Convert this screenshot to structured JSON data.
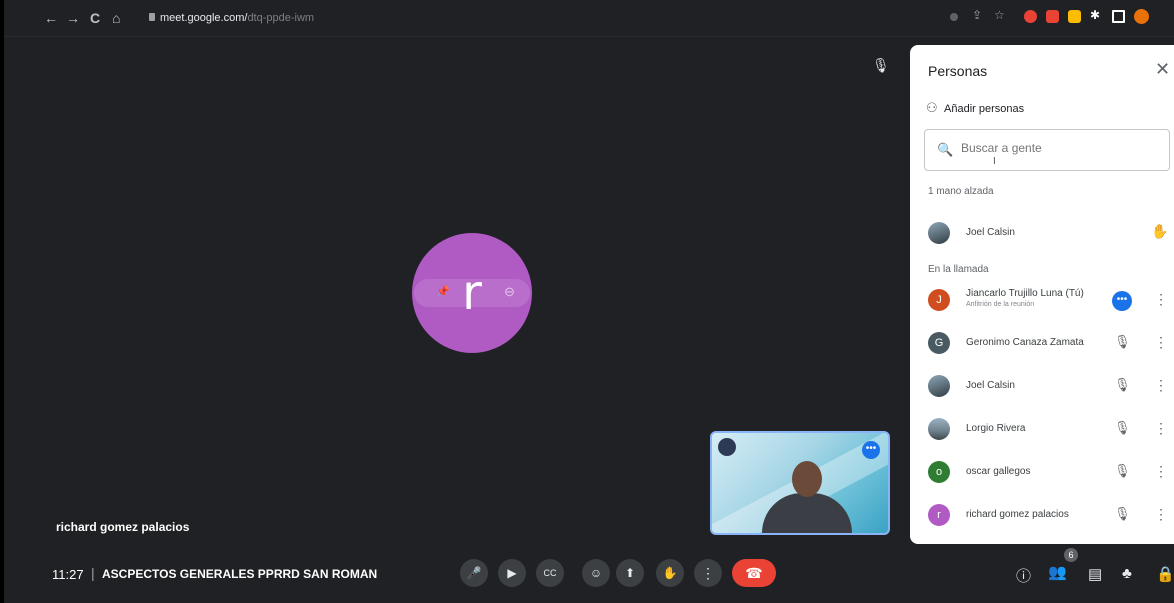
{
  "browser": {
    "url_host": "meet.google.com/",
    "url_path": "dtq-ppde-iwm",
    "nav": [
      "←",
      "→",
      "C",
      "⌂"
    ]
  },
  "stage": {
    "avatar_letter": "r",
    "tile_name": "richard gomez palacios",
    "avatar_color": "#b05bc4"
  },
  "panel": {
    "title": "Personas",
    "add_people": "Añadir personas",
    "search_placeholder": "Buscar a gente",
    "raised_hands_label": "1 mano alzada",
    "raised": [
      {
        "name": "Joel Calsin"
      }
    ],
    "in_call_label": "En la llamada",
    "in_call": [
      {
        "name": "Jiancarlo Trujillo Luna (Tú)",
        "subtitle": "Anfitrión de la reunión",
        "initial": "J",
        "color": "#d04d1f"
      },
      {
        "name": "Geronimo Canaza Zamata",
        "initial": "G",
        "color": "#4a5a63"
      },
      {
        "name": "Joel Calsin",
        "initial": "",
        "color": ""
      },
      {
        "name": "Lorgio Rivera",
        "initial": "",
        "color": ""
      },
      {
        "name": "oscar gallegos",
        "initial": "o",
        "color": "#2e7d32"
      },
      {
        "name": "richard gomez palacios",
        "initial": "r",
        "color": "#b05bc4"
      }
    ]
  },
  "bottom": {
    "time": "11:27",
    "meeting_title": "ASCPECTOS GENERALES PPRRD SAN ROMAN",
    "people_count": "6"
  }
}
